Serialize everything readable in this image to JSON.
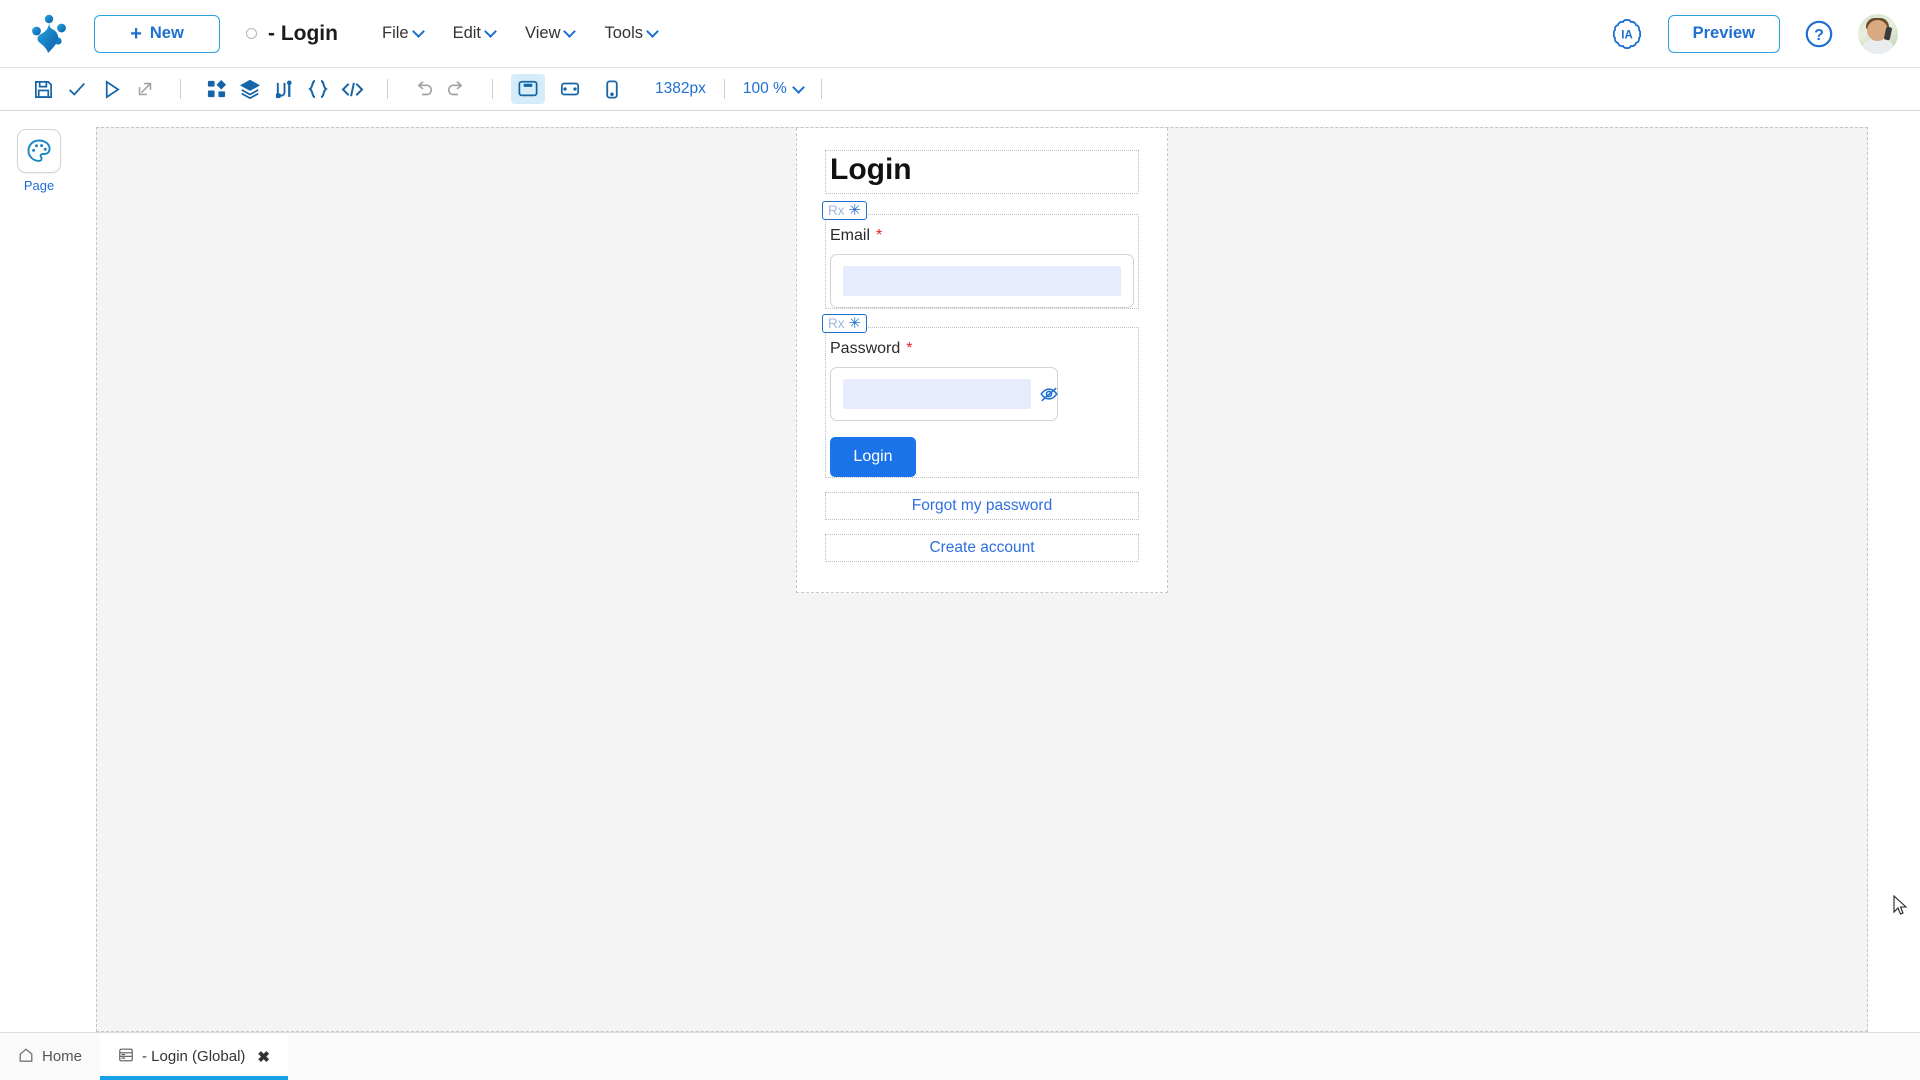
{
  "app": {
    "logo_icon": "frog-footprint-logo",
    "new_button": {
      "label": "New",
      "icon": "plus-icon"
    },
    "document": {
      "title": "- Login",
      "state_icon": "unsaved-dot"
    },
    "menus": [
      {
        "label": "File",
        "icon": "chevron-down-icon"
      },
      {
        "label": "Edit",
        "icon": "chevron-down-icon"
      },
      {
        "label": "View",
        "icon": "chevron-down-icon"
      },
      {
        "label": "Tools",
        "icon": "chevron-down-icon"
      }
    ],
    "top_right": {
      "ai_badge": {
        "label": "IA",
        "icon": "ai-cloud-icon"
      },
      "preview_label": "Preview",
      "help_icon": "question-circle-icon",
      "avatar": "user-avatar"
    }
  },
  "toolbar": {
    "actions": [
      {
        "name": "save-icon",
        "title": "Save"
      },
      {
        "name": "validate-check-icon",
        "title": "Validate"
      },
      {
        "name": "run-play-icon",
        "title": "Run"
      },
      {
        "name": "open-external-icon",
        "title": "Open in new window"
      }
    ],
    "tools": [
      {
        "name": "widgets-grid-icon",
        "title": "Widgets"
      },
      {
        "name": "layers-icon",
        "title": "Layers"
      },
      {
        "name": "connectors-icon",
        "title": "Connectors"
      },
      {
        "name": "braces-icon",
        "title": "Variables"
      },
      {
        "name": "code-icon",
        "title": "Code"
      }
    ],
    "history": [
      {
        "name": "undo-icon",
        "title": "Undo"
      },
      {
        "name": "redo-icon",
        "title": "Redo"
      }
    ],
    "viewports": [
      {
        "name": "desktop-view-icon",
        "title": "Desktop",
        "active": true
      },
      {
        "name": "tablet-view-icon",
        "title": "Tablet",
        "active": false
      },
      {
        "name": "mobile-view-icon",
        "title": "Mobile",
        "active": false
      }
    ],
    "width_label": "1382px",
    "zoom_label": "100 %",
    "zoom_caret_icon": "chevron-down-icon"
  },
  "left_rail": {
    "items": [
      {
        "label": "Page",
        "icon": "palette-icon",
        "active": true
      }
    ]
  },
  "canvas": {
    "login_card": {
      "title": "Login",
      "fields": [
        {
          "label": "Email",
          "required_marker": "*",
          "badge": {
            "text": "Rx",
            "icon": "asterisk-icon"
          },
          "value": "",
          "has_toggle": false
        },
        {
          "label": "Password",
          "required_marker": "*",
          "badge": {
            "text": "Rx",
            "icon": "asterisk-icon"
          },
          "value": "",
          "has_toggle": true,
          "toggle_icon": "eye-off-icon"
        }
      ],
      "submit_label": "Login",
      "links": [
        "Forgot my password",
        "Create account"
      ]
    }
  },
  "bottom_tabs": [
    {
      "label": "Home",
      "icon": "home-icon",
      "active": false,
      "closable": false
    },
    {
      "label": "- Login (Global)",
      "icon": "page-icon",
      "active": true,
      "closable": true,
      "close_icon": "close-x-icon"
    }
  ],
  "colors": {
    "accent_blue": "#1f6fd0",
    "primary_button": "#1a73e8",
    "tab_underline": "#17a2e8",
    "required_red": "#e02222",
    "input_fill": "#e6ecfb"
  }
}
